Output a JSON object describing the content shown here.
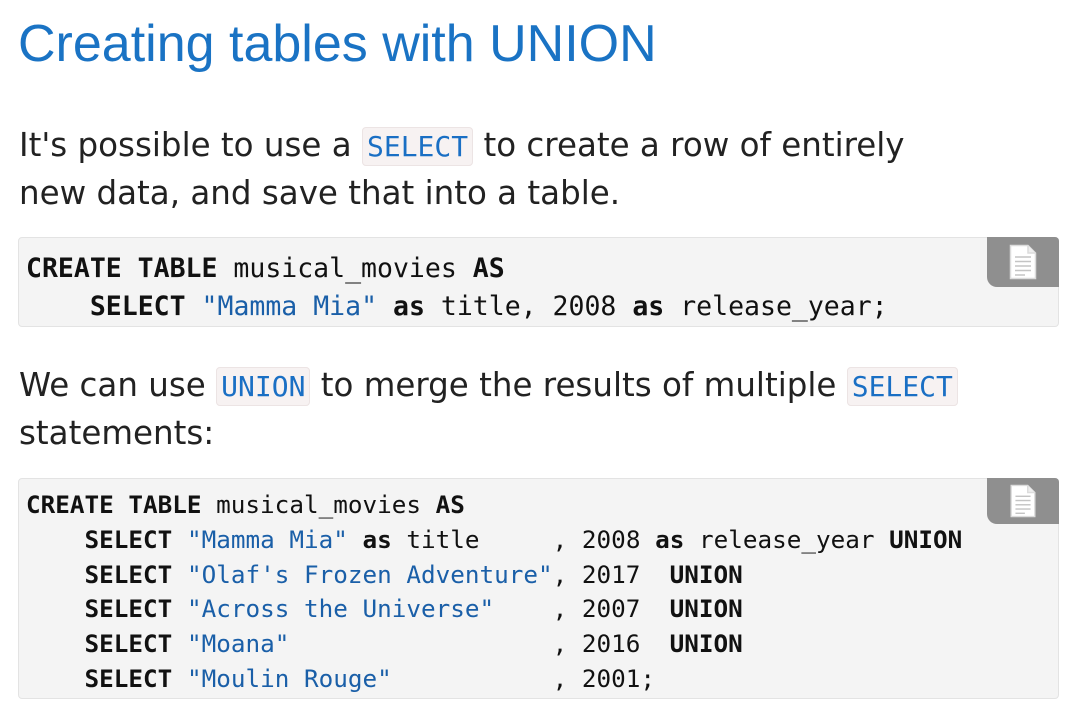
{
  "page": {
    "title": "Creating tables with UNION"
  },
  "intro": {
    "before": "It's possible to use a ",
    "code": "SELECT",
    "after": " to create a row of entirely new data, and save that into a table."
  },
  "code_block_1": {
    "line1": {
      "kw1": "CREATE TABLE",
      "t1": " musical_movies ",
      "kw2": "AS"
    },
    "line2": {
      "indent": "    ",
      "kw1": "SELECT",
      "sp1": " ",
      "str1": "\"Mamma Mia\"",
      "sp2": " ",
      "kw2": "as",
      "t1": " title, 2008 ",
      "kw3": "as",
      "t2": " release_year;"
    }
  },
  "union_para": {
    "before": "We can use ",
    "code1": "UNION",
    "middle": " to merge the results of multiple ",
    "code2": "SELECT",
    "after": " statements:"
  },
  "code_block_2": {
    "lines": [
      {
        "indent": "",
        "kw1": "CREATE TABLE",
        "t1": " musical_movies ",
        "kw2": "AS"
      },
      {
        "indent": "    ",
        "kw1": "SELECT",
        "sp": " ",
        "str": "\"Mamma Mia\"",
        "sp2": " ",
        "kw2": "as",
        "t1": " title     , 2008 ",
        "kw3": "as",
        "t2": " release_year ",
        "kw4": "UNION"
      },
      {
        "indent": "    ",
        "kw1": "SELECT",
        "sp": " ",
        "str": "\"Olaf's Frozen Adventure\"",
        "t1": ", 2017  ",
        "kw4": "UNION"
      },
      {
        "indent": "    ",
        "kw1": "SELECT",
        "sp": " ",
        "str": "\"Across the Universe\"",
        "t1": "    , 2007  ",
        "kw4": "UNION"
      },
      {
        "indent": "    ",
        "kw1": "SELECT",
        "sp": " ",
        "str": "\"Moana\"",
        "t1": "                  , 2016  ",
        "kw4": "UNION"
      },
      {
        "indent": "    ",
        "kw1": "SELECT",
        "sp": " ",
        "str": "\"Moulin Rouge\"",
        "t1": "           , 2001;"
      }
    ]
  },
  "icons": {
    "copy_1": "copy-document-icon",
    "copy_2": "copy-document-icon"
  },
  "colors": {
    "heading": "#1a73c4",
    "inline_code": "#1a6fc4",
    "string_literal": "#1a5fa8",
    "code_background": "#f4f4f4",
    "copy_button": "#8f8f8f"
  }
}
